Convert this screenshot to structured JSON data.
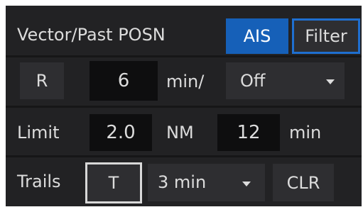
{
  "panel": {
    "title": "Vector/Past POSN",
    "ais_label": "AIS",
    "filter_label": "Filter"
  },
  "vector": {
    "r_label": "R",
    "minutes_value": "6",
    "minutes_unit": "min/",
    "mode_value": "Off",
    "mode_icon": "dropdown-caret-icon"
  },
  "limit": {
    "label": "Limit",
    "distance_value": "2.0",
    "distance_unit": "NM",
    "time_value": "12",
    "time_unit": "min"
  },
  "trails": {
    "label": "Trails",
    "t_label": "T",
    "interval_value": "3 min",
    "interval_icon": "dropdown-caret-icon",
    "clr_label": "CLR"
  },
  "colors": {
    "panel_bg": "#222224",
    "ais_active": "#1660b8",
    "filter_border": "#1f6fd0",
    "text": "#dcdcdc"
  }
}
